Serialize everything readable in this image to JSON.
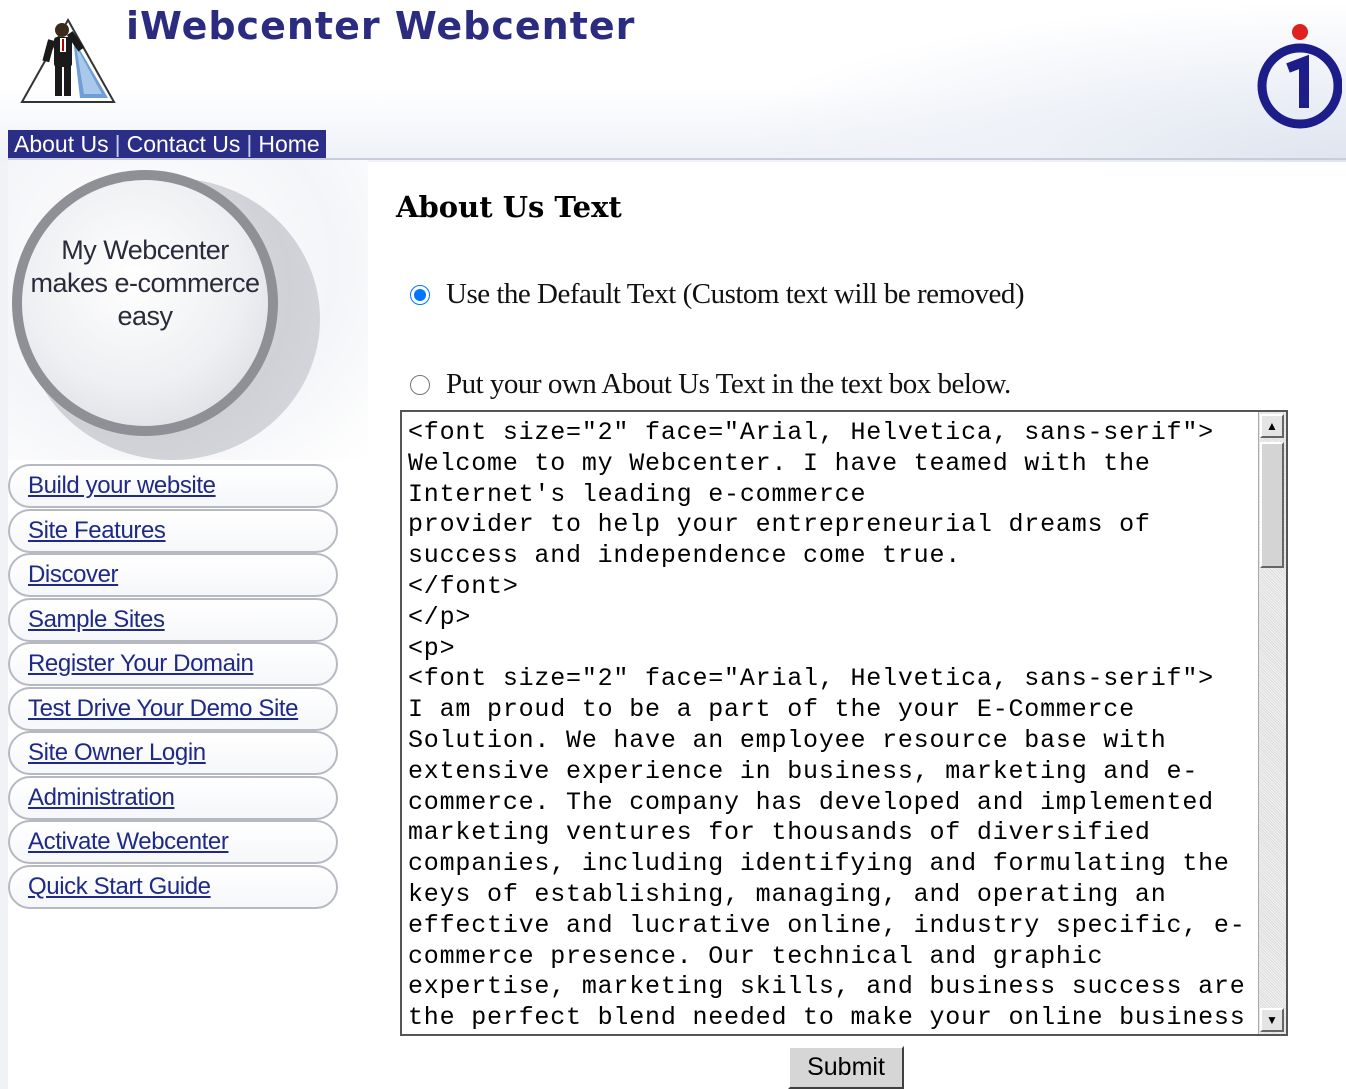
{
  "header": {
    "title": "iWebcenter Webcenter",
    "logo_icon": "businessman-triangle-logo-icon",
    "brand_icon": "info-i-circle-icon"
  },
  "topnav": {
    "items": [
      "About Us",
      "Contact Us",
      "Home"
    ],
    "separator": "|"
  },
  "sidebar": {
    "badge_lines": [
      "My Webcenter",
      "makes e-commerce",
      "easy"
    ],
    "menu": [
      "Build your website",
      "Site Features",
      "Discover",
      "Sample Sites",
      "Register Your Domain",
      "Test Drive Your Demo Site",
      "Site Owner Login",
      "Administration",
      "Activate Webcenter",
      "Quick Start Guide"
    ]
  },
  "main": {
    "section_title": "About Us Text",
    "option_default_label": "Use the Default Text (Custom text will be removed)",
    "option_custom_label": "Put your own About Us Text in the text box below.",
    "selected_option": "default",
    "textarea_value": "<font size=\"2\" face=\"Arial, Helvetica, sans-serif\">\nWelcome to my Webcenter. I have teamed with the\nInternet's leading e-commerce\nprovider to help your entrepreneurial dreams of\nsuccess and independence come true.\n</font>\n</p>\n<p>\n<font size=\"2\" face=\"Arial, Helvetica, sans-serif\">\nI am proud to be a part of the your E-Commerce\nSolution. We have an employee resource base with\nextensive experience in business, marketing and e-\ncommerce. The company has developed and implemented\nmarketing ventures for thousands of diversified\ncompanies, including identifying and formulating the\nkeys of establishing, managing, and operating an\neffective and lucrative online, industry specific, e-\ncommerce presence. Our technical and graphic\nexpertise, marketing skills, and business success are\nthe perfect blend needed to make your online business",
    "submit_label": "Submit"
  },
  "colors": {
    "brand_blue": "#2b2e86",
    "menu_text": "#1f2a86",
    "title_text": "#2b2b80"
  }
}
